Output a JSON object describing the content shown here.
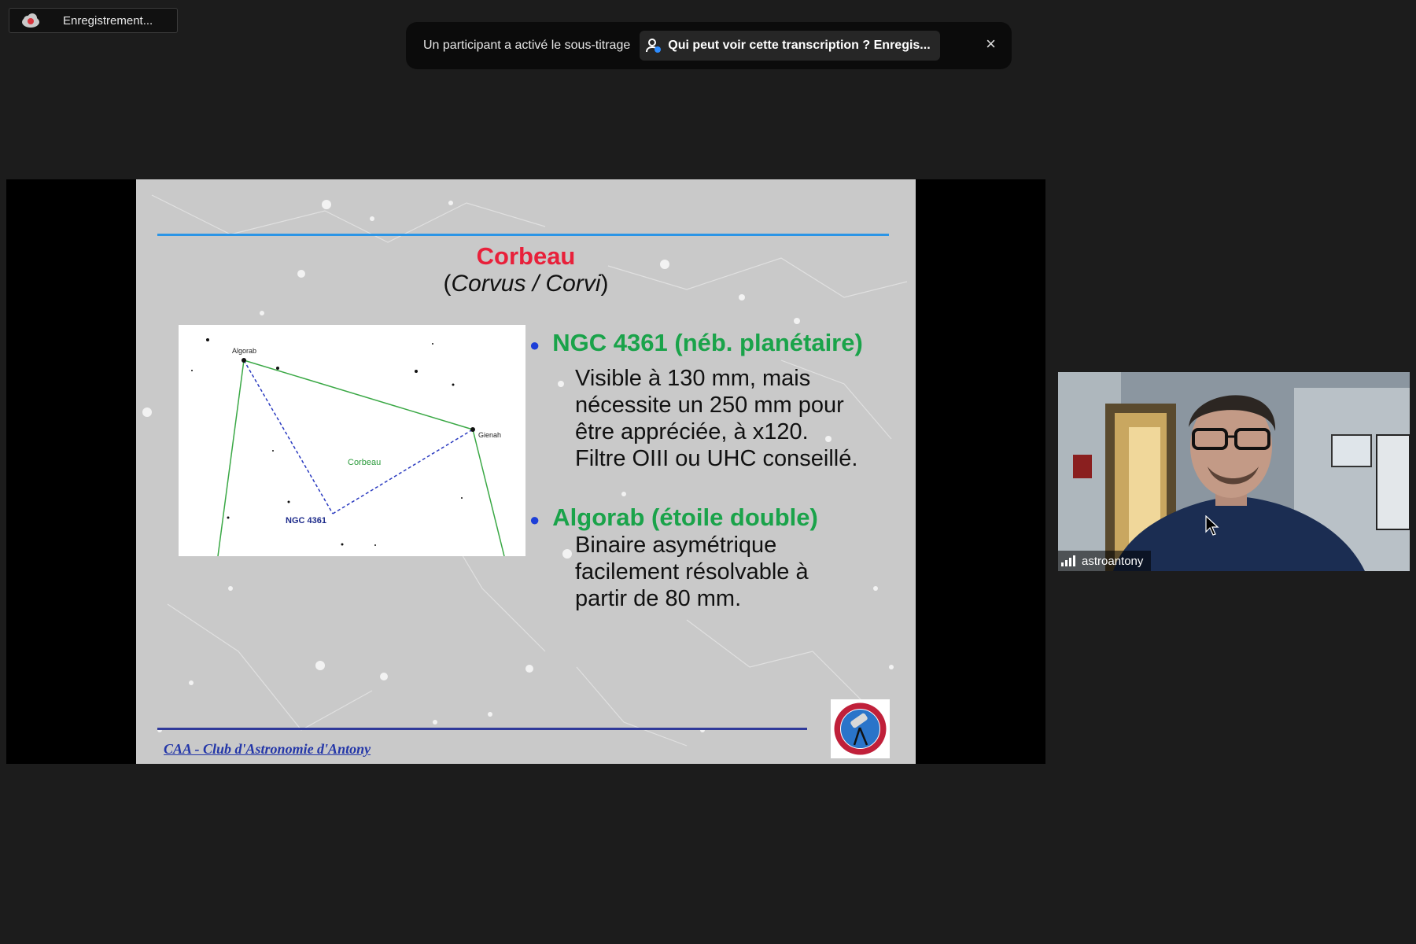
{
  "recording": {
    "label": "Enregistrement...",
    "icon": "cloud-record-icon"
  },
  "caption_banner": {
    "message": "Un participant a activé le sous-titrage",
    "who_label": "Qui peut voir cette transcription ? Enregis...",
    "close": "×"
  },
  "slide": {
    "title": "Corbeau",
    "subtitle_open": "(",
    "subtitle_italic": "Corvus / Corvi",
    "subtitle_close": ")",
    "chart": {
      "constellation_label": "Corbeau",
      "star_algorab": "Algorab",
      "star_gienah": "Gienah",
      "object_label": "NGC 4361"
    },
    "bullets": [
      {
        "heading": "NGC 4361 (néb. planétaire)",
        "lines": [
          "Visible à 130 mm, mais",
          "nécessite un 250 mm pour",
          "être appréciée, à x120.",
          "Filtre OIII ou UHC conseillé."
        ]
      },
      {
        "heading": "Algorab (étoile double)",
        "lines": [
          "Binaire asymétrique",
          "facilement résolvable à",
          "partir de 80 mm."
        ]
      }
    ],
    "footer": "CAA - Club d'Astronomie d'Antony",
    "colors": {
      "title": "#e8203a",
      "bullet_heading": "#1aa34a",
      "rule_top": "#2b95e6",
      "rule_bottom": "#303a9a"
    }
  },
  "video_tile": {
    "participant_name": "astroantony",
    "icon": "signal-bars-icon"
  }
}
